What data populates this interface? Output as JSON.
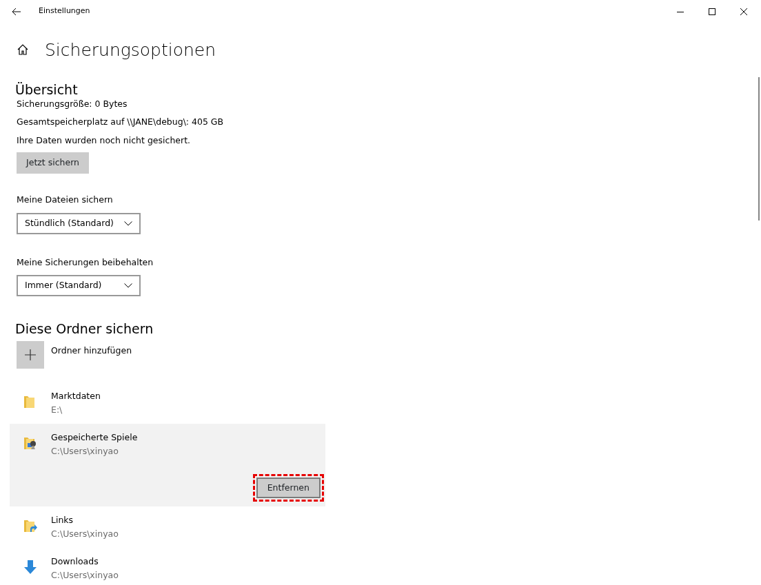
{
  "window": {
    "title": "Einstellungen"
  },
  "page_title": "Sicherungsoptionen",
  "overview": {
    "heading": "Übersicht",
    "lines": [
      "Sicherungsgröße: 0 Bytes",
      "Gesamtspeicherplatz auf \\\\JANE\\debug\\: 405 GB",
      "Ihre Daten wurden noch nicht gesichert."
    ],
    "button": "Jetzt sichern"
  },
  "settings": [
    {
      "label": "Meine Dateien sichern",
      "value": "Stündlich (Standard)"
    },
    {
      "label": "Meine Sicherungen beibehalten",
      "value": "Immer (Standard)"
    }
  ],
  "folders": {
    "heading": "Diese Ordner sichern",
    "add_label": "Ordner hinzufügen",
    "items": [
      {
        "kind": "folder",
        "name": "Marktdaten",
        "path": "E:\\",
        "selected": false
      },
      {
        "kind": "games",
        "name": "Gespeicherte Spiele",
        "path": "C:\\Users\\xinyao",
        "selected": true,
        "button": "Entfernen"
      },
      {
        "kind": "links",
        "name": "Links",
        "path": "C:\\Users\\xinyao",
        "selected": false
      },
      {
        "kind": "download",
        "name": "Downloads",
        "path": "C:\\Users\\xinyao",
        "selected": false
      }
    ]
  }
}
